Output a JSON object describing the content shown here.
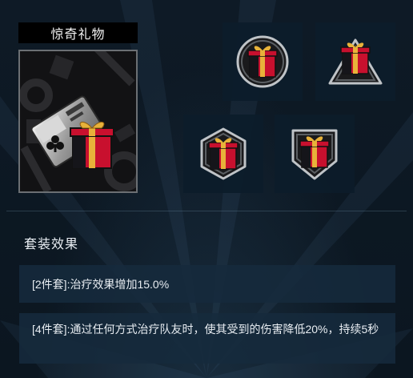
{
  "item": {
    "title": "惊奇礼物",
    "image_icon": "gift-box-on-card-icon"
  },
  "pieces": [
    {
      "icon": "gift-box-icon",
      "frame": "circle"
    },
    {
      "icon": "gift-box-icon",
      "frame": "triangle"
    },
    {
      "icon": "gift-box-icon",
      "frame": "hexagon"
    },
    {
      "icon": "gift-box-icon",
      "frame": "shield"
    }
  ],
  "set_effects": {
    "title": "套装效果",
    "two_piece": "[2件套]:治疗效果增加15.0%",
    "four_piece": "[4件套]:通过任何方式治疗队友时，使其受到的伤害降低20%，持续5秒"
  },
  "colors": {
    "background": "#0d1824",
    "row_background": "#162a3c",
    "gift_red": "#c8102e",
    "gift_gold": "#e8b23a",
    "gift_black": "#15151a"
  }
}
